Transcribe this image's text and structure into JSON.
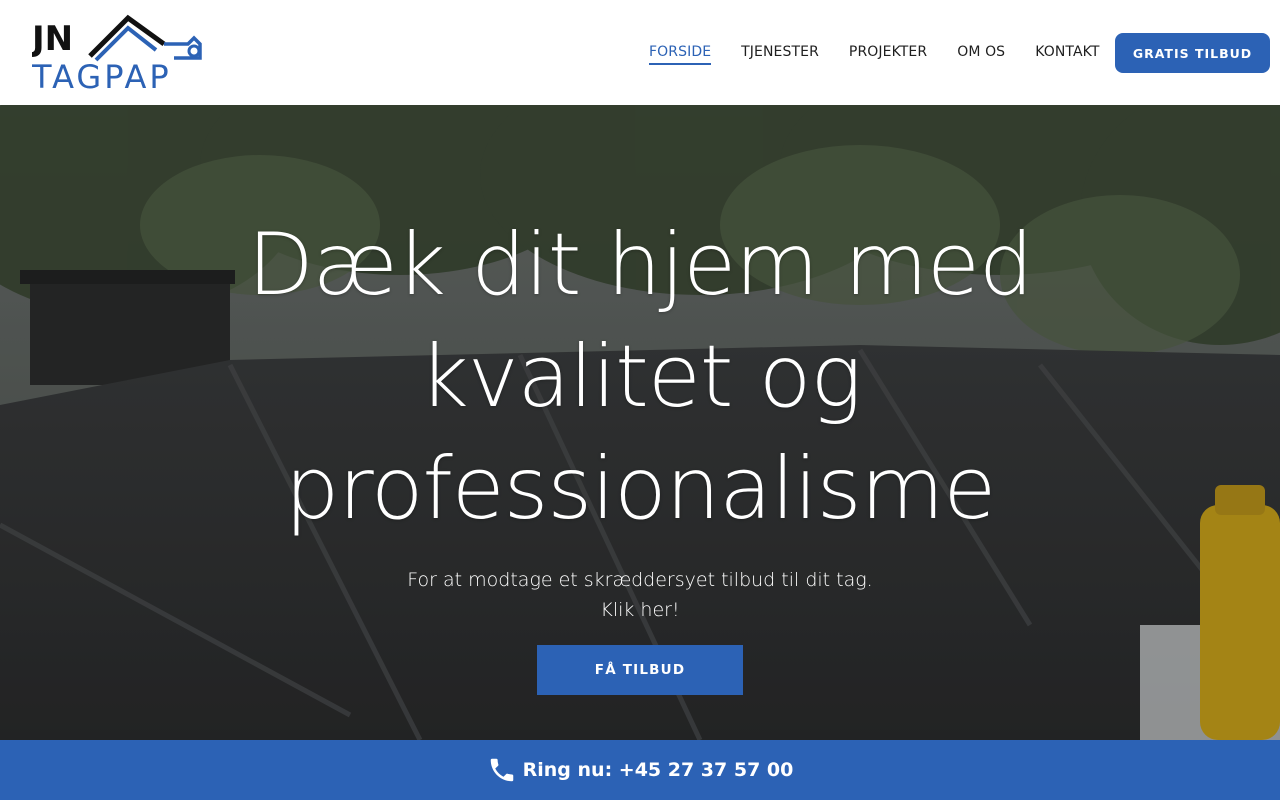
{
  "brand": {
    "logo_top": "JN",
    "logo_bottom": "TAGPAP"
  },
  "nav": {
    "items": [
      {
        "label": "FORSIDE",
        "active": true
      },
      {
        "label": "TJENESTER",
        "active": false
      },
      {
        "label": "PROJEKTER",
        "active": false
      },
      {
        "label": "OM OS",
        "active": false
      },
      {
        "label": "KONTAKT",
        "active": false
      }
    ],
    "cta_label": "GRATIS TILBUD"
  },
  "hero": {
    "title_lines": [
      "Dæk dit hjem med",
      "kvalitet og",
      "professionalisme"
    ],
    "subtitle_lines": [
      "For at modtage et skræddersyet tilbud til dit tag.",
      "Klik her!"
    ],
    "button_label": "FÅ TILBUD"
  },
  "callbar": {
    "text": "Ring nu: +45 27 37 57 00",
    "icon": "phone-icon"
  },
  "colors": {
    "accent": "#2c62b5",
    "text_dark": "#1f1f1f",
    "white": "#ffffff"
  }
}
